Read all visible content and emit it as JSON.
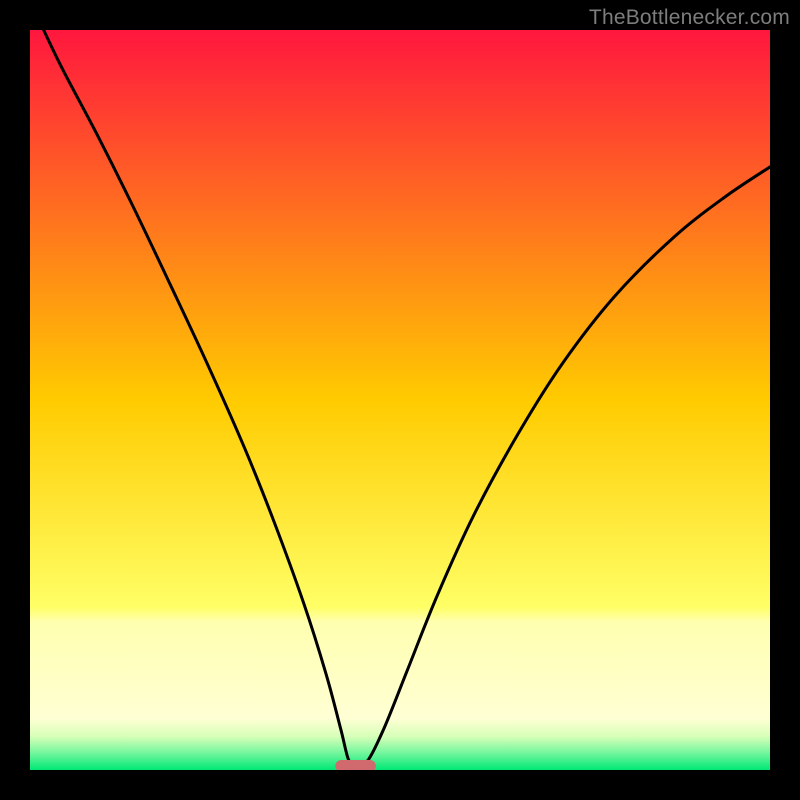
{
  "watermark": "TheBottlenecker.com",
  "chart_data": {
    "type": "line",
    "title": "",
    "xlabel": "",
    "ylabel": "",
    "xlim": [
      0,
      1
    ],
    "ylim": [
      0,
      1
    ],
    "gradient_stops": [
      {
        "offset": 0.0,
        "color": "#ff173e"
      },
      {
        "offset": 0.5,
        "color": "#ffcb00"
      },
      {
        "offset": 0.78,
        "color": "#ffff66"
      },
      {
        "offset": 0.8,
        "color": "#ffffb0"
      },
      {
        "offset": 0.93,
        "color": "#ffffd4"
      },
      {
        "offset": 0.955,
        "color": "#d6ffb8"
      },
      {
        "offset": 0.975,
        "color": "#7cf7a0"
      },
      {
        "offset": 1.0,
        "color": "#00e876"
      }
    ],
    "curve": {
      "minimum_x": 0.44,
      "left_branch": [
        {
          "x": 0.0,
          "y": 1.04
        },
        {
          "x": 0.04,
          "y": 0.955
        },
        {
          "x": 0.09,
          "y": 0.86
        },
        {
          "x": 0.14,
          "y": 0.76
        },
        {
          "x": 0.19,
          "y": 0.655
        },
        {
          "x": 0.24,
          "y": 0.548
        },
        {
          "x": 0.29,
          "y": 0.435
        },
        {
          "x": 0.33,
          "y": 0.335
        },
        {
          "x": 0.37,
          "y": 0.225
        },
        {
          "x": 0.4,
          "y": 0.13
        },
        {
          "x": 0.42,
          "y": 0.055
        },
        {
          "x": 0.43,
          "y": 0.015
        },
        {
          "x": 0.44,
          "y": 0.0
        }
      ],
      "right_branch": [
        {
          "x": 0.44,
          "y": 0.0
        },
        {
          "x": 0.458,
          "y": 0.015
        },
        {
          "x": 0.48,
          "y": 0.06
        },
        {
          "x": 0.51,
          "y": 0.135
        },
        {
          "x": 0.55,
          "y": 0.235
        },
        {
          "x": 0.6,
          "y": 0.345
        },
        {
          "x": 0.66,
          "y": 0.455
        },
        {
          "x": 0.72,
          "y": 0.55
        },
        {
          "x": 0.79,
          "y": 0.64
        },
        {
          "x": 0.87,
          "y": 0.72
        },
        {
          "x": 0.94,
          "y": 0.775
        },
        {
          "x": 1.0,
          "y": 0.815
        }
      ]
    },
    "marker": {
      "center_x": 0.44,
      "width": 0.055,
      "color": "#d16a6f"
    }
  }
}
